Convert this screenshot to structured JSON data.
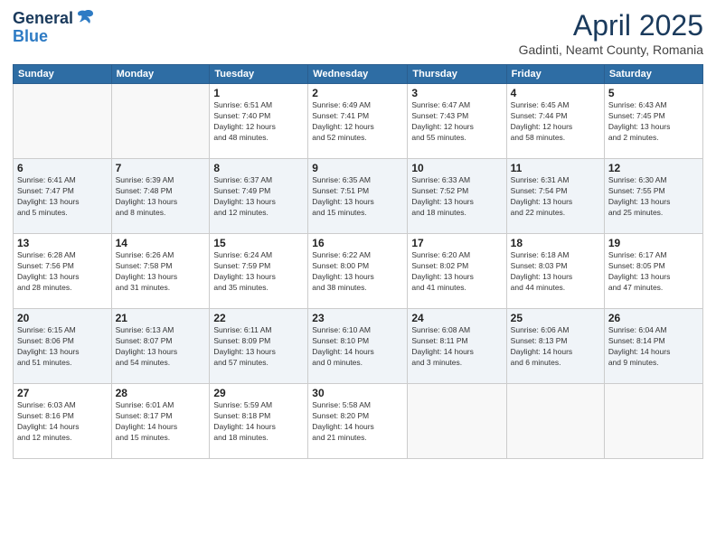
{
  "header": {
    "logo_line1": "General",
    "logo_line2": "Blue",
    "month": "April 2025",
    "location": "Gadinti, Neamt County, Romania"
  },
  "weekdays": [
    "Sunday",
    "Monday",
    "Tuesday",
    "Wednesday",
    "Thursday",
    "Friday",
    "Saturday"
  ],
  "weeks": [
    [
      {
        "day": "",
        "info": ""
      },
      {
        "day": "",
        "info": ""
      },
      {
        "day": "1",
        "info": "Sunrise: 6:51 AM\nSunset: 7:40 PM\nDaylight: 12 hours\nand 48 minutes."
      },
      {
        "day": "2",
        "info": "Sunrise: 6:49 AM\nSunset: 7:41 PM\nDaylight: 12 hours\nand 52 minutes."
      },
      {
        "day": "3",
        "info": "Sunrise: 6:47 AM\nSunset: 7:43 PM\nDaylight: 12 hours\nand 55 minutes."
      },
      {
        "day": "4",
        "info": "Sunrise: 6:45 AM\nSunset: 7:44 PM\nDaylight: 12 hours\nand 58 minutes."
      },
      {
        "day": "5",
        "info": "Sunrise: 6:43 AM\nSunset: 7:45 PM\nDaylight: 13 hours\nand 2 minutes."
      }
    ],
    [
      {
        "day": "6",
        "info": "Sunrise: 6:41 AM\nSunset: 7:47 PM\nDaylight: 13 hours\nand 5 minutes."
      },
      {
        "day": "7",
        "info": "Sunrise: 6:39 AM\nSunset: 7:48 PM\nDaylight: 13 hours\nand 8 minutes."
      },
      {
        "day": "8",
        "info": "Sunrise: 6:37 AM\nSunset: 7:49 PM\nDaylight: 13 hours\nand 12 minutes."
      },
      {
        "day": "9",
        "info": "Sunrise: 6:35 AM\nSunset: 7:51 PM\nDaylight: 13 hours\nand 15 minutes."
      },
      {
        "day": "10",
        "info": "Sunrise: 6:33 AM\nSunset: 7:52 PM\nDaylight: 13 hours\nand 18 minutes."
      },
      {
        "day": "11",
        "info": "Sunrise: 6:31 AM\nSunset: 7:54 PM\nDaylight: 13 hours\nand 22 minutes."
      },
      {
        "day": "12",
        "info": "Sunrise: 6:30 AM\nSunset: 7:55 PM\nDaylight: 13 hours\nand 25 minutes."
      }
    ],
    [
      {
        "day": "13",
        "info": "Sunrise: 6:28 AM\nSunset: 7:56 PM\nDaylight: 13 hours\nand 28 minutes."
      },
      {
        "day": "14",
        "info": "Sunrise: 6:26 AM\nSunset: 7:58 PM\nDaylight: 13 hours\nand 31 minutes."
      },
      {
        "day": "15",
        "info": "Sunrise: 6:24 AM\nSunset: 7:59 PM\nDaylight: 13 hours\nand 35 minutes."
      },
      {
        "day": "16",
        "info": "Sunrise: 6:22 AM\nSunset: 8:00 PM\nDaylight: 13 hours\nand 38 minutes."
      },
      {
        "day": "17",
        "info": "Sunrise: 6:20 AM\nSunset: 8:02 PM\nDaylight: 13 hours\nand 41 minutes."
      },
      {
        "day": "18",
        "info": "Sunrise: 6:18 AM\nSunset: 8:03 PM\nDaylight: 13 hours\nand 44 minutes."
      },
      {
        "day": "19",
        "info": "Sunrise: 6:17 AM\nSunset: 8:05 PM\nDaylight: 13 hours\nand 47 minutes."
      }
    ],
    [
      {
        "day": "20",
        "info": "Sunrise: 6:15 AM\nSunset: 8:06 PM\nDaylight: 13 hours\nand 51 minutes."
      },
      {
        "day": "21",
        "info": "Sunrise: 6:13 AM\nSunset: 8:07 PM\nDaylight: 13 hours\nand 54 minutes."
      },
      {
        "day": "22",
        "info": "Sunrise: 6:11 AM\nSunset: 8:09 PM\nDaylight: 13 hours\nand 57 minutes."
      },
      {
        "day": "23",
        "info": "Sunrise: 6:10 AM\nSunset: 8:10 PM\nDaylight: 14 hours\nand 0 minutes."
      },
      {
        "day": "24",
        "info": "Sunrise: 6:08 AM\nSunset: 8:11 PM\nDaylight: 14 hours\nand 3 minutes."
      },
      {
        "day": "25",
        "info": "Sunrise: 6:06 AM\nSunset: 8:13 PM\nDaylight: 14 hours\nand 6 minutes."
      },
      {
        "day": "26",
        "info": "Sunrise: 6:04 AM\nSunset: 8:14 PM\nDaylight: 14 hours\nand 9 minutes."
      }
    ],
    [
      {
        "day": "27",
        "info": "Sunrise: 6:03 AM\nSunset: 8:16 PM\nDaylight: 14 hours\nand 12 minutes."
      },
      {
        "day": "28",
        "info": "Sunrise: 6:01 AM\nSunset: 8:17 PM\nDaylight: 14 hours\nand 15 minutes."
      },
      {
        "day": "29",
        "info": "Sunrise: 5:59 AM\nSunset: 8:18 PM\nDaylight: 14 hours\nand 18 minutes."
      },
      {
        "day": "30",
        "info": "Sunrise: 5:58 AM\nSunset: 8:20 PM\nDaylight: 14 hours\nand 21 minutes."
      },
      {
        "day": "",
        "info": ""
      },
      {
        "day": "",
        "info": ""
      },
      {
        "day": "",
        "info": ""
      }
    ]
  ]
}
